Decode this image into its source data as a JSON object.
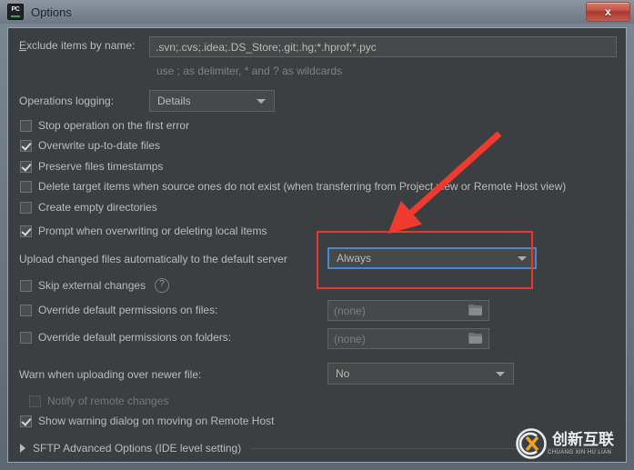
{
  "window": {
    "title": "Options",
    "app_icon": "pycharm-icon",
    "icon_text": "PC",
    "close_label": "x"
  },
  "form": {
    "exclude": {
      "label": "Exclude items by name:",
      "label_mnemonic": "E",
      "value": ".svn;.cvs;.idea;.DS_Store;.git;.hg;*.hprof;*.pyc",
      "hint": "use ; as delimiter, * and ? as wildcards"
    },
    "operations_logging": {
      "label": "Operations logging:",
      "value": "Details"
    },
    "checkboxes": [
      {
        "label": "Stop operation on the first error",
        "checked": false,
        "disabled": false
      },
      {
        "label": "Overwrite up-to-date files",
        "checked": true,
        "disabled": false
      },
      {
        "label": "Preserve files timestamps",
        "checked": true,
        "disabled": false
      },
      {
        "label": "Delete target items when source ones do not exist (when transferring from Project view or Remote Host view)",
        "checked": false,
        "disabled": false
      },
      {
        "label": "Create empty directories",
        "checked": false,
        "disabled": false
      },
      {
        "label": "Prompt when overwriting or deleting local items",
        "checked": true,
        "disabled": false
      }
    ],
    "upload_changed": {
      "label": "Upload changed files automatically to the default server",
      "value": "Always",
      "focused": true
    },
    "skip_external": {
      "label": "Skip external changes",
      "checked": false,
      "help_icon": "question-mark-icon"
    },
    "override_files": {
      "label": "Override default permissions on files:",
      "checked": false,
      "value": "(none)",
      "browse_icon": "folder-icon"
    },
    "override_folders": {
      "label": "Override default permissions on folders:",
      "checked": false,
      "value": "(none)",
      "browse_icon": "folder-icon"
    },
    "warn_newer": {
      "label": "Warn when uploading over newer file:",
      "value": "No"
    },
    "notify_remote": {
      "label": "Notify of remote changes",
      "checked": false,
      "disabled": true
    },
    "show_warning": {
      "label": "Show warning dialog on moving on Remote Host",
      "checked": true,
      "disabled": false
    },
    "sftp_advanced": {
      "label": "SFTP Advanced Options (IDE level setting)",
      "expanded": false,
      "triangle_icon": "chevron-right-icon"
    }
  },
  "annotations": {
    "highlight_color": "#e8372c",
    "arrow_color": "#f03a2e",
    "focus_color": "#4a88c7"
  },
  "watermark": {
    "chinese": "创新互联",
    "pinyin": "CHUANG XIN HU LIAN",
    "logo_icon": "cx-circle-logo"
  }
}
